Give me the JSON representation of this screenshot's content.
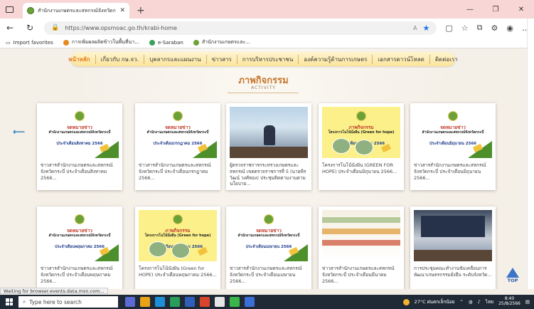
{
  "browser": {
    "tab_title": "สำนักงานเกษตรและสหกรณ์จังหวัดกระบี่",
    "url": "https://www.opsmoac.go.th/krabi-home",
    "favorites": [
      {
        "label": "Import favorites"
      },
      {
        "label": "การเพิ่มผลผลิตข้าวในพื้นที่นา..."
      },
      {
        "label": "e-Saraban"
      },
      {
        "label": "สำนักงานเกษตรและ..."
      }
    ]
  },
  "nav": {
    "items": [
      "หน้าหลัก",
      "เกี่ยวกับ กษ.จว.",
      "บุคลากรและแผนงาน",
      "ข่าวสาร",
      "การบริหารประชาชน",
      "องค์ความรู้ด้านการเกษตร",
      "เอกสารดาวน์โหลด",
      "ติดต่อเรา"
    ],
    "active_index": 0
  },
  "section": {
    "title": "ภาพกิจกรรม",
    "subtitle": "ACTIVITY"
  },
  "cards": [
    {
      "thumb": "green",
      "heading": "จดหมายข่าว",
      "sub": "สำนักงานเกษตรและสหกรณ์จังหวัดกระบี่",
      "period": "ประจำเดือนสิงหาคม 2566",
      "text": "ข่าวสารสำนักงานเกษตรและสหกรณ์จังหวัดกระบี่ ประจำเดือนสิงหาคม 2566..."
    },
    {
      "thumb": "green",
      "heading": "จดหมายข่าว",
      "sub": "สำนักงานเกษตรและสหกรณ์จังหวัดกระบี่",
      "period": "ประจำเดือนกรกฎาคม 2566",
      "text": "ข่าวสารสำนักงานเกษตรและสหกรณ์จังหวัดกระบี่ ประจำเดือนกรกฎาคม 2566..."
    },
    {
      "thumb": "photo",
      "heading": "",
      "sub": "",
      "period": "",
      "text": "ผู้ตรวจราชการกระทรวงเกษตรและสหกรณ์ เขตตรวจราชการที่ 5 (นายพีรวัฒน์ วงศ์ทอง) ประชุมติดตามงานตามนโยบาย..."
    },
    {
      "thumb": "yellow",
      "heading": "ภาพกิจกรรม",
      "sub": "โครงการโนโน้นั่งฝัน (Green for hope)",
      "period": "ประจำเดือนมิถุนายน 2566",
      "text": "โครงการโนโน้นั่งฝัน (GREEN FOR HOPE) ประจำเดือนมิถุนายน 2566..."
    },
    {
      "thumb": "green",
      "heading": "จดหมายข่าว",
      "sub": "สำนักงานเกษตรและสหกรณ์จังหวัดกระบี่",
      "period": "ประจำเดือนมิถุนายน 2566",
      "text": "ข่าวสารสำนักงานเกษตรและสหกรณ์จังหวัดกระบี่ ประจำเดือนมิถุนายน 2566..."
    },
    {
      "thumb": "green",
      "heading": "จดหมายข่าว",
      "sub": "สำนักงานเกษตรและสหกรณ์จังหวัดกระบี่",
      "period": "ประจำเดือนพฤษภาคม 2566",
      "text": "ข่าวสารสำนักงานเกษตรและสหกรณ์จังหวัดกระบี่ ประจำเดือนพฤษภาคม 2566..."
    },
    {
      "thumb": "yellow",
      "heading": "ภาพกิจกรรม",
      "sub": "โครงการโนโน้นั่งฝัน (Green for hope)",
      "period": "ประจำเดือนพฤษภาคม 2566",
      "text": "โครงการโนโน้นั่งฝัน (Green for HOPE) ประจำเดือนพฤษภาคม 2566..."
    },
    {
      "thumb": "green",
      "heading": "จดหมายข่าว",
      "sub": "สำนักงานเกษตรและสหกรณ์จังหวัดกระบี่",
      "period": "ประจำเดือนเมษายน 2566",
      "text": "ข่าวสารสำนักงานเกษตรและสหกรณ์จังหวัดกระบี่ ประจำเดือนเมษายน 2566..."
    },
    {
      "thumb": "chart",
      "heading": "",
      "sub": "",
      "period": "",
      "text": "ข่าวสารสำนักงานเกษตรและสหกรณ์จังหวัดกระบี่ ประจำเดือนมีนาคม 2566..."
    },
    {
      "thumb": "meeting",
      "heading": "",
      "sub": "",
      "period": "",
      "text": "การประชุมคณะทำงานขับเคลื่อนการพัฒนาเกษตรกรรมยั่งยืน ระดับจังหวัด..."
    }
  ],
  "page_status": "Waiting for browser.events.data.msn.com...",
  "top_label": "TOP",
  "taskbar": {
    "search_placeholder": "Type here to search",
    "weather": "27°C ฝนตกเล็กน้อย",
    "lang": "ไทย",
    "time": "8:40",
    "date": "25/8/2566"
  }
}
